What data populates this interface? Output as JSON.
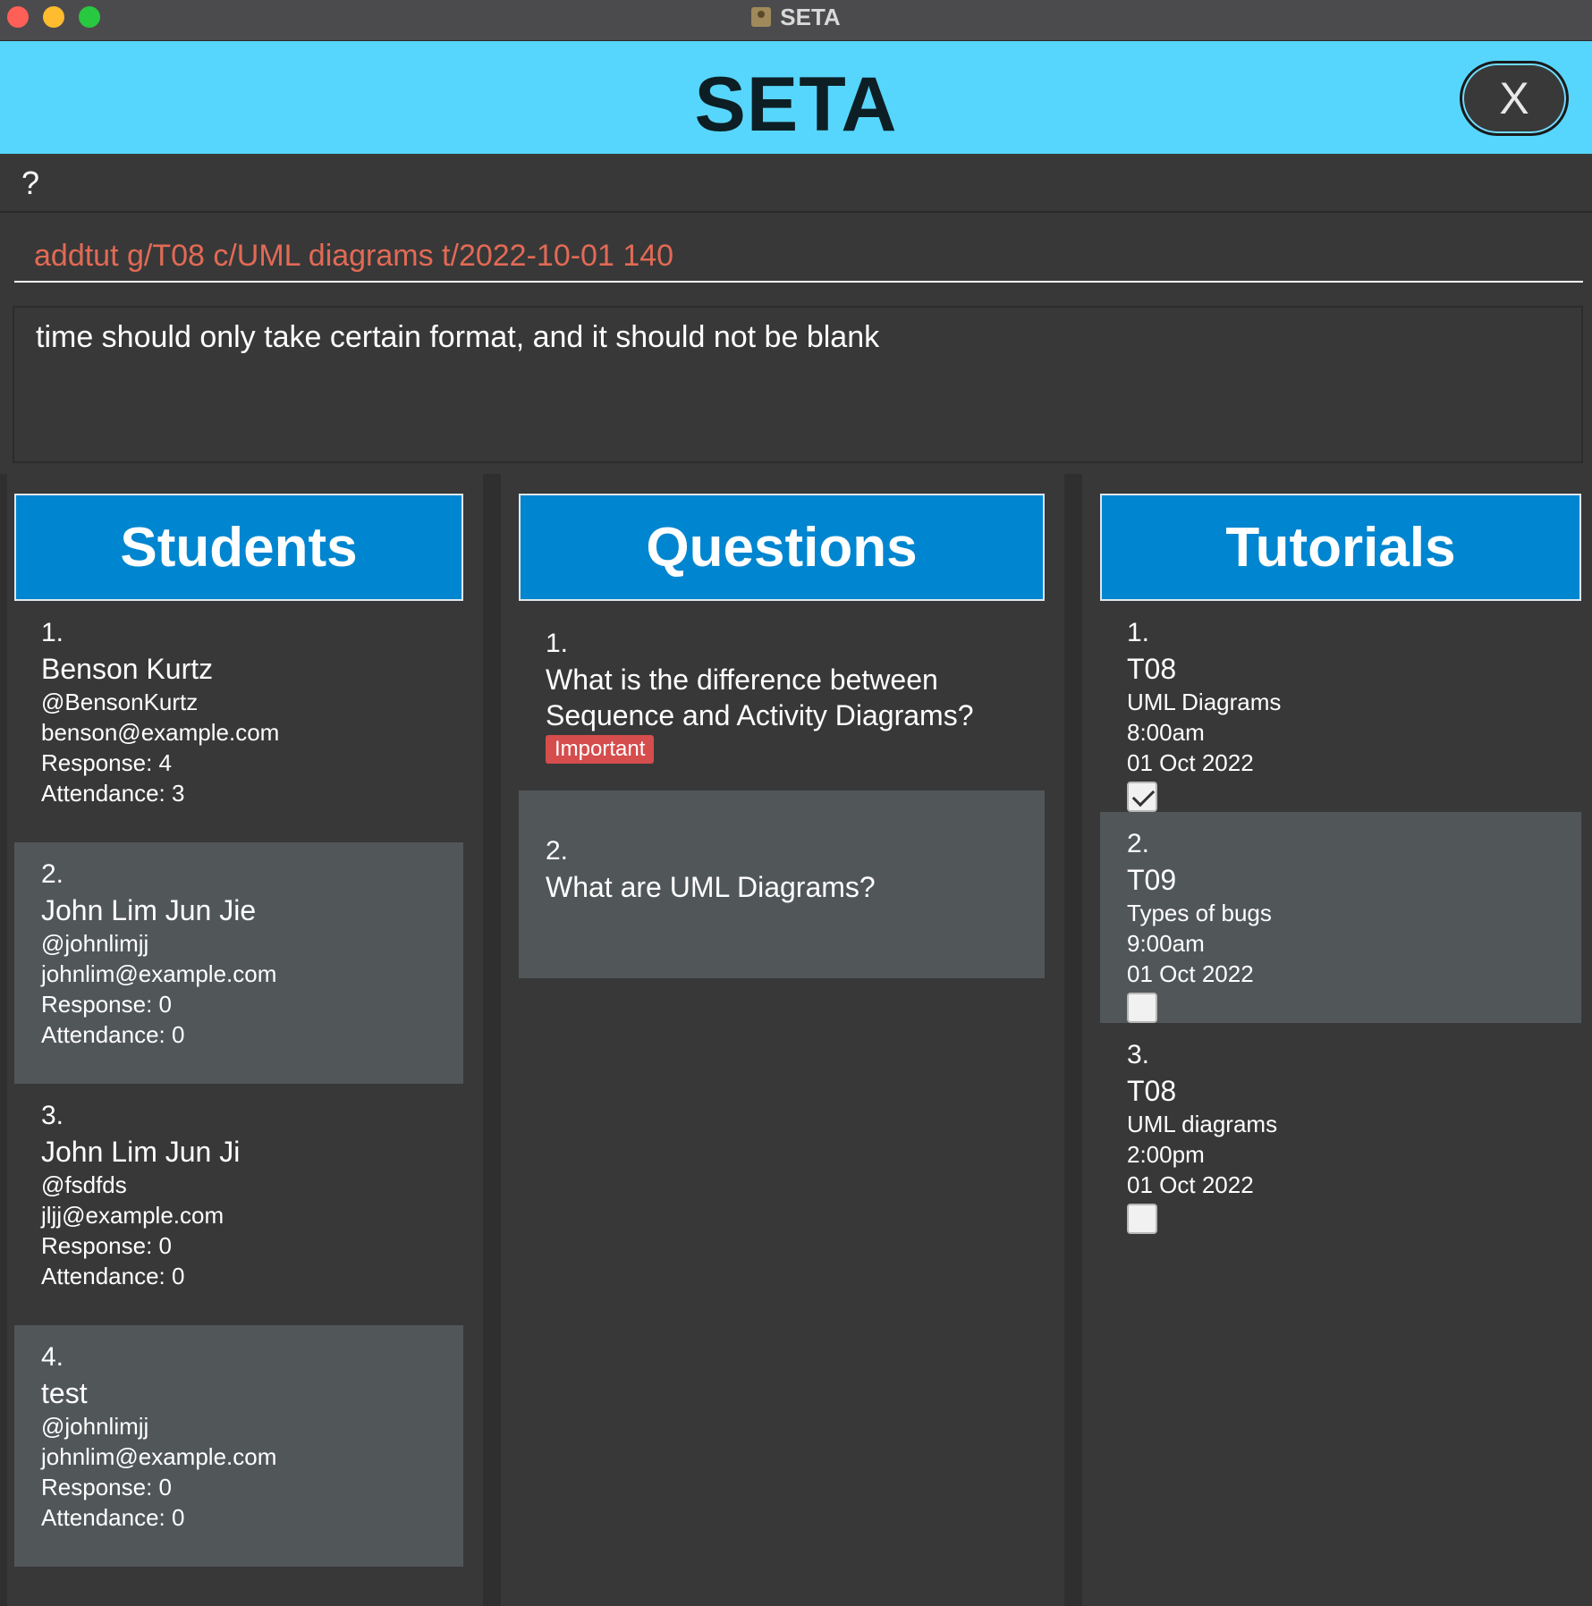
{
  "window": {
    "title": "SETA"
  },
  "header": {
    "title": "SETA",
    "close_label": "X"
  },
  "help": {
    "label": "?"
  },
  "command": {
    "value": "addtut g/T08 c/UML diagrams t/2022-10-01 140"
  },
  "result": {
    "text": "time should only take certain format, and it should not be blank"
  },
  "students": {
    "title": "Students",
    "items": [
      {
        "index": "1.",
        "name": "Benson Kurtz",
        "telegram": "@BensonKurtz",
        "email": "benson@example.com",
        "response": "Response: 4",
        "attendance": "Attendance: 3"
      },
      {
        "index": "2.",
        "name": "John Lim Jun Jie",
        "telegram": "@johnlimjj",
        "email": "johnlim@example.com",
        "response": "Response: 0",
        "attendance": "Attendance: 0"
      },
      {
        "index": "3.",
        "name": "John Lim Jun Ji",
        "telegram": "@fsdfds",
        "email": "jljj@example.com",
        "response": "Response: 0",
        "attendance": "Attendance: 0"
      },
      {
        "index": "4.",
        "name": "test",
        "telegram": "@johnlimjj",
        "email": "johnlim@example.com",
        "response": "Response: 0",
        "attendance": "Attendance: 0"
      }
    ]
  },
  "questions": {
    "title": "Questions",
    "items": [
      {
        "index": "1.",
        "text": "What is the difference between Sequence and Activity Diagrams?",
        "tag": "Important"
      },
      {
        "index": "2.",
        "text": "What are UML Diagrams?",
        "tag": ""
      }
    ]
  },
  "tutorials": {
    "title": "Tutorials",
    "items": [
      {
        "index": "1.",
        "group": "T08",
        "content": "UML Diagrams",
        "time": "8:00am",
        "date": "01 Oct 2022",
        "done": true
      },
      {
        "index": "2.",
        "group": "T09",
        "content": "Types of bugs",
        "time": "9:00am",
        "date": "01 Oct 2022",
        "done": false
      },
      {
        "index": "3.",
        "group": "T08",
        "content": "UML diagrams",
        "time": "2:00pm",
        "date": "01 Oct 2022",
        "done": false
      }
    ]
  }
}
